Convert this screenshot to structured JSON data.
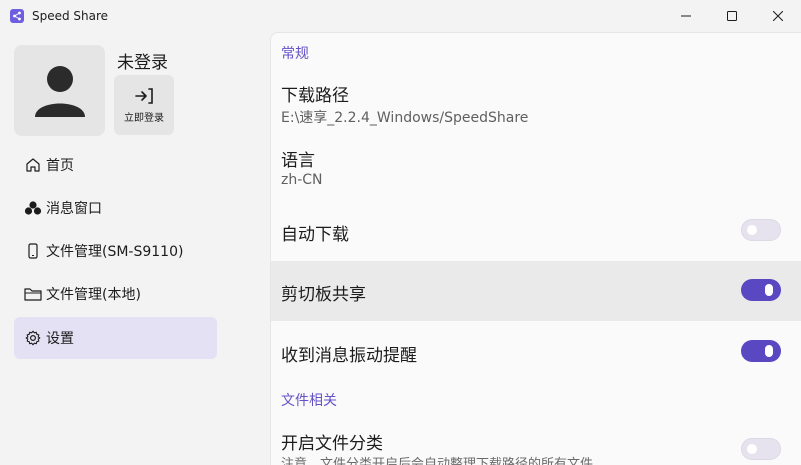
{
  "window": {
    "title": "Speed Share",
    "app_icon": "share-icon",
    "controls": [
      "minimize-icon",
      "maximize-icon",
      "close-icon"
    ]
  },
  "user": {
    "name": "未登录",
    "login_label": "立即登录",
    "avatar_icon": "person-icon",
    "login_icon": "login-arrow-icon"
  },
  "nav": {
    "home": "首页",
    "messages": "消息窗口",
    "remote_files": "文件管理(SM-S9110)",
    "local_files": "文件管理(本地)",
    "settings": "设置",
    "active": "settings"
  },
  "settings": {
    "section_general": "常规",
    "download_path_title": "下载路径",
    "download_path_value": "E:\\速享_2.2.4_Windows/SpeedShare",
    "language_title": "语言",
    "language_value": "zh-CN",
    "auto_download": {
      "label": "自动下载",
      "on": false
    },
    "clipboard_share": {
      "label": "剪切板共享",
      "on": true
    },
    "vibrate_on_message": {
      "label": "收到消息振动提醒",
      "on": true
    },
    "section_files": "文件相关",
    "file_classify": {
      "label": "开启文件分类",
      "on": false
    },
    "file_classify_note": "注意，文件分类开启后会自动整理下载路径的所有文件"
  },
  "colors": {
    "accent": "#5a47c2",
    "section_header": "#6652c8",
    "active_nav_bg": "#e3e1f3"
  }
}
